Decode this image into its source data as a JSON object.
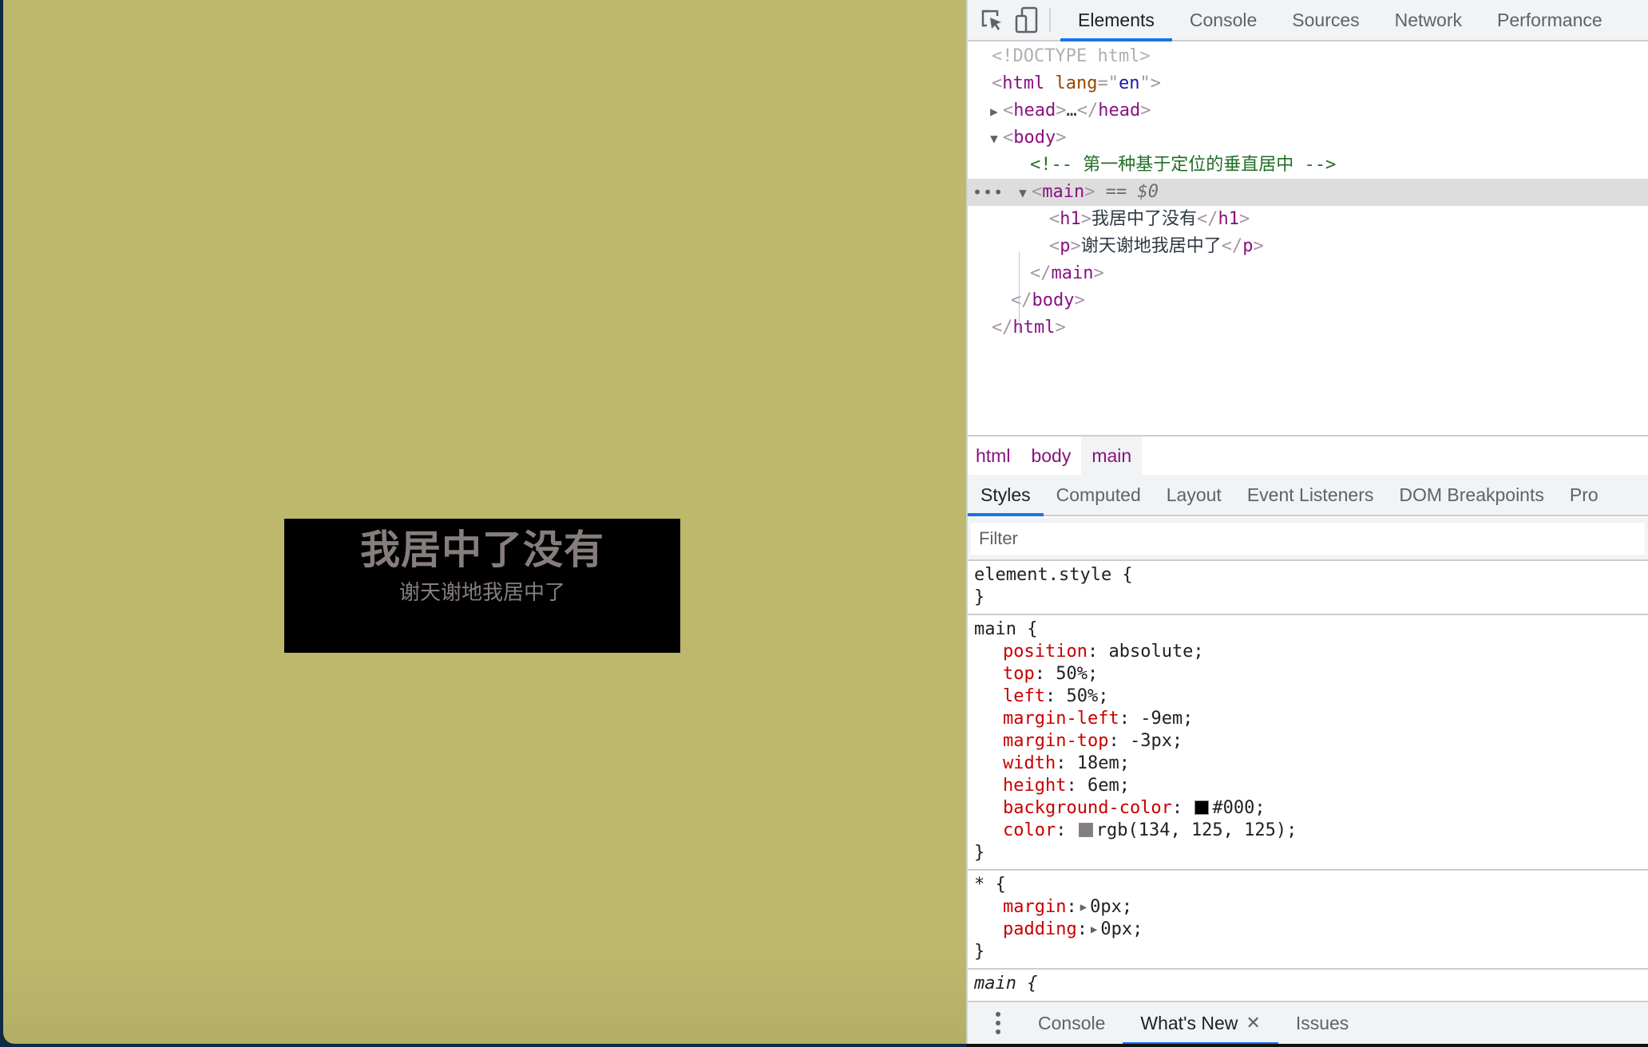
{
  "page": {
    "background_color": "#bdb86c",
    "main": {
      "heading": "我居中了没有",
      "paragraph": "谢天谢地我居中了",
      "background_color": "#000",
      "text_color": "rgb(134, 125, 125)"
    }
  },
  "devtools": {
    "toolbar": {
      "inspect_icon": "inspect-element-icon",
      "device_icon": "device-toolbar-icon"
    },
    "tabs": [
      "Elements",
      "Console",
      "Sources",
      "Network",
      "Performance"
    ],
    "active_tab": "Elements",
    "dom_tree": {
      "doctype": "<!DOCTYPE html>",
      "html_tag": "html",
      "lang_attr": "lang",
      "lang_value": "en",
      "head_tag": "head",
      "head_ellipsis": "…",
      "body_tag": "body",
      "comment": "<!-- 第一种基于定位的垂直居中 -->",
      "main_tag": "main",
      "selected_marker": "== $0",
      "h1_tag": "h1",
      "h1_text": "我居中了没有",
      "p_tag": "p",
      "p_text": "谢天谢地我居中了",
      "row_ellipsis": "•••"
    },
    "breadcrumb": [
      "html",
      "body",
      "main"
    ],
    "styles_tabs": [
      "Styles",
      "Computed",
      "Layout",
      "Event Listeners",
      "DOM Breakpoints",
      "Properties"
    ],
    "styles_tabs_visible": [
      "Styles",
      "Computed",
      "Layout",
      "Event Listeners",
      "DOM Breakpoints",
      "Pro"
    ],
    "active_styles_tab": "Styles",
    "filter": {
      "placeholder": "Filter",
      "value": ""
    },
    "rules": [
      {
        "selector": "element.style {",
        "close": "}",
        "declarations": []
      },
      {
        "selector": "main {",
        "close": "}",
        "declarations": [
          {
            "name": "position",
            "value": "absolute;"
          },
          {
            "name": "top",
            "value": "50%;"
          },
          {
            "name": "left",
            "value": "50%;"
          },
          {
            "name": "margin-left",
            "value": "-9em;"
          },
          {
            "name": "margin-top",
            "value": "-3px;"
          },
          {
            "name": "width",
            "value": "18em;"
          },
          {
            "name": "height",
            "value": "6em;"
          },
          {
            "name": "background-color",
            "value": "#000;",
            "swatch": "#000000"
          },
          {
            "name": "color",
            "value": "rgb(134, 125, 125);",
            "swatch": "#867d7d"
          }
        ]
      },
      {
        "selector": "* {",
        "close": "}",
        "declarations": [
          {
            "name": "margin",
            "value": "0px;",
            "expandable": true
          },
          {
            "name": "padding",
            "value": "0px;",
            "expandable": true
          }
        ]
      },
      {
        "selector": "main {",
        "partial": true
      }
    ],
    "drawer": {
      "tabs": [
        "Console",
        "What's New",
        "Issues"
      ],
      "active_tab": "What's New",
      "close_icon": "close-icon"
    },
    "colors": {
      "accent": "#1a73e8",
      "tag": "#881280",
      "attr_name": "#994500",
      "attr_value": "#1a1aa6",
      "comment": "#236e25",
      "css_property": "#c80000"
    }
  }
}
